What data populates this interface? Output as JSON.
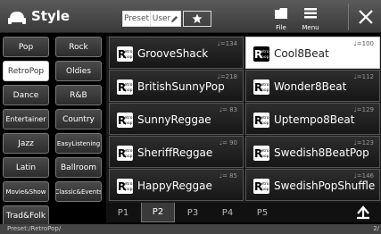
{
  "header": {
    "title": "Style",
    "preset_label": "Preset",
    "user_label": "User",
    "file_label": "File",
    "menu_label": "Menu"
  },
  "genres": [
    {
      "label": "Pop",
      "selected": false
    },
    {
      "label": "Rock",
      "selected": false
    },
    {
      "label": "RetroPop",
      "selected": true
    },
    {
      "label": "Oldies",
      "selected": false
    },
    {
      "label": "Dance",
      "selected": false
    },
    {
      "label": "R&B",
      "selected": false
    },
    {
      "label": "Entertainer",
      "selected": false
    },
    {
      "label": "Country",
      "selected": false
    },
    {
      "label": "Jazz",
      "selected": false
    },
    {
      "label": "EasyListening",
      "selected": false
    },
    {
      "label": "Latin",
      "selected": false
    },
    {
      "label": "Ballroom",
      "selected": false
    },
    {
      "label": "Movie&Show",
      "selected": false
    },
    {
      "label": "Classic&Events",
      "selected": false
    },
    {
      "label": "Trad&Folk",
      "selected": false
    }
  ],
  "styles": [
    {
      "name": "GrooveShack",
      "tempo": "♩=134",
      "selected": false
    },
    {
      "name": "Cool8Beat",
      "tempo": "♩=100",
      "selected": true
    },
    {
      "name": "BritishSunnyPop",
      "tempo": "♩=218",
      "selected": false
    },
    {
      "name": "Wonder8Beat",
      "tempo": "♩=112",
      "selected": false
    },
    {
      "name": "SunnyReggae",
      "tempo": "♩= 83",
      "selected": false
    },
    {
      "name": "Uptempo8Beat",
      "tempo": "♩=129",
      "selected": false
    },
    {
      "name": "SheriffReggae",
      "tempo": "♩= 90",
      "selected": false
    },
    {
      "name": "Swedish8BeatPop",
      "tempo": "♩=123",
      "selected": false
    },
    {
      "name": "HappyReggae",
      "tempo": "♩= 85",
      "selected": false
    },
    {
      "name": "SwedishPopShuffle",
      "tempo": "♩=146",
      "selected": false
    }
  ],
  "pages": [
    {
      "label": "P1",
      "selected": false
    },
    {
      "label": "P2",
      "selected": true
    },
    {
      "label": "P3",
      "selected": false
    },
    {
      "label": "P4",
      "selected": false
    },
    {
      "label": "P5",
      "selected": false
    }
  ],
  "footer": {
    "path": "Preset:/RetroPop/",
    "page_indicator": "2/"
  },
  "colors": {
    "selected_bg": "#ffffff",
    "button_bg": "#3a3a3a",
    "background": "#000000"
  }
}
